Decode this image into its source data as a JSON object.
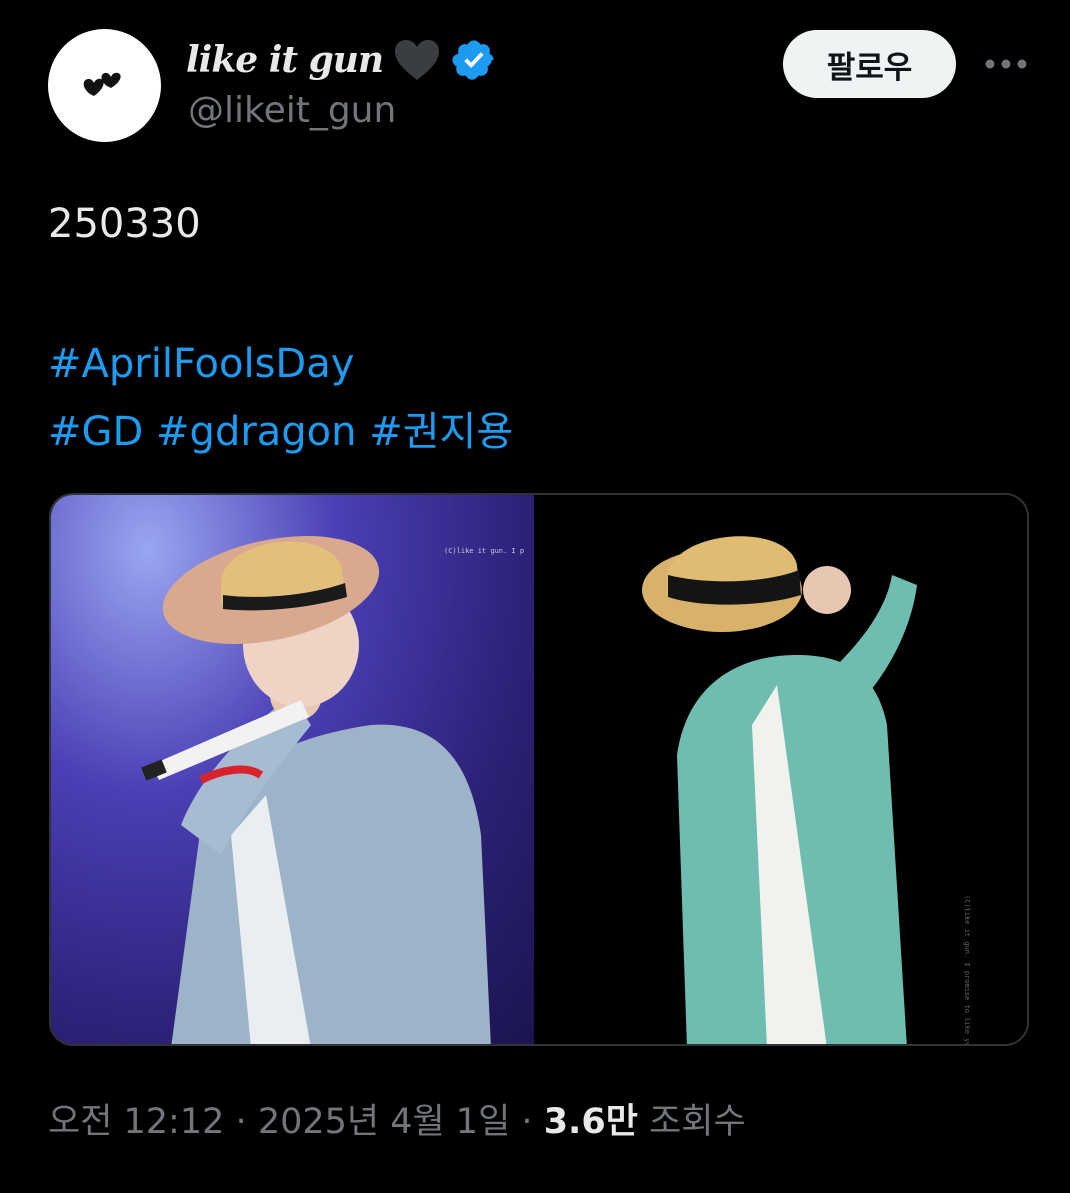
{
  "header": {
    "display_name": "like it gun",
    "name_emoji_icon": "black-heart-icon",
    "verified_icon": "verified-badge-icon",
    "handle": "@likeit_gun",
    "follow_label": "팔로우",
    "more_icon": "more-horizontal-icon",
    "avatar_icon": "two-black-hearts-icon"
  },
  "tweet": {
    "date_line": "250330",
    "hashtags_line1": [
      "#AprilFoolsDay"
    ],
    "hashtags_line2": [
      "#GD",
      "#gdragon",
      "#권지용"
    ]
  },
  "media": {
    "left_watermark": "(C)like it gun. I p",
    "right_watermark": "(C)like it gun. I promise to like you"
  },
  "meta": {
    "time": "오전 12:12",
    "separator": "·",
    "date": "2025년 4월 1일",
    "views_count": "3.6만",
    "views_label": "조회수"
  },
  "colors": {
    "background": "#000000",
    "text": "#e7e9ea",
    "muted": "#71767b",
    "link": "#1d9bf0",
    "verified": "#1d9bf0",
    "follow_bg": "#eff3f4"
  }
}
